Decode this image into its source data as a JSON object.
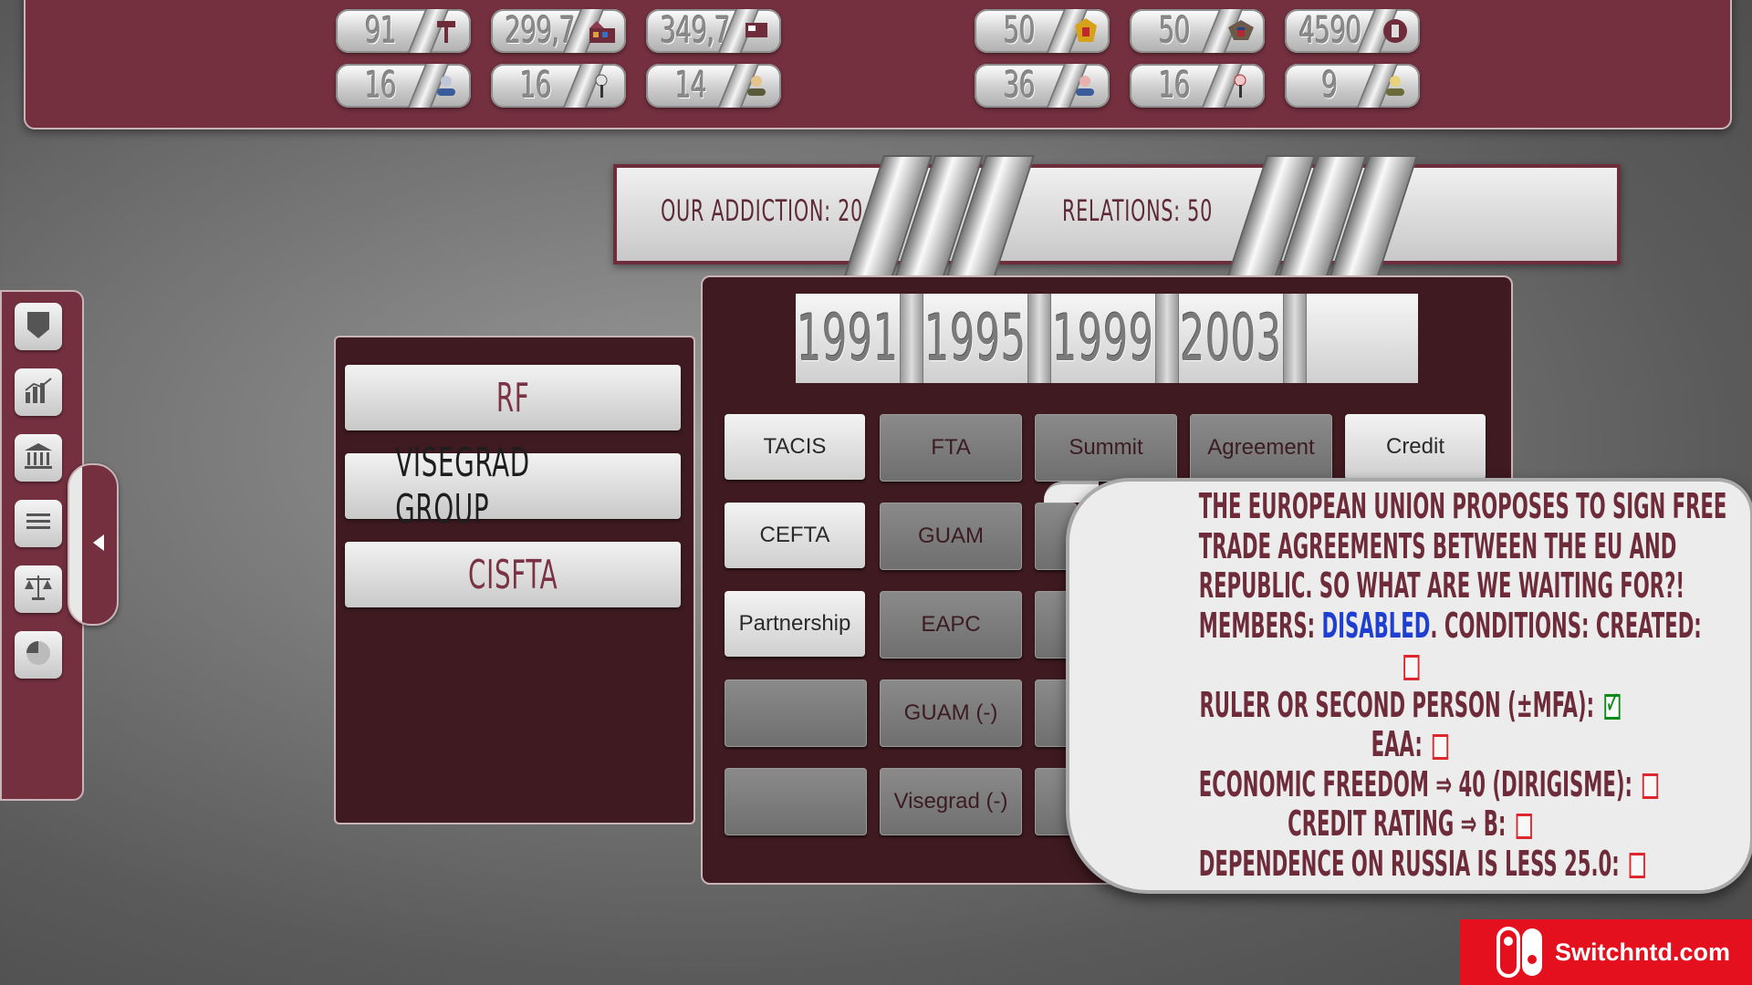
{
  "top_stats": {
    "row1": [
      {
        "value": "91",
        "icon": "tools-icon"
      },
      {
        "value": "299,7",
        "icon": "factory-icon"
      },
      {
        "value": "349,7",
        "icon": "money-flag-icon"
      },
      {
        "value": "50",
        "icon": "russia-eagle-icon"
      },
      {
        "value": "50",
        "icon": "us-eagle-icon"
      },
      {
        "value": "4590",
        "icon": "coin-icon"
      }
    ],
    "row2": [
      {
        "value": "16",
        "icon": "person-icon"
      },
      {
        "value": "16",
        "icon": "microphone-icon"
      },
      {
        "value": "14",
        "icon": "leader-icon"
      },
      {
        "value": "36",
        "icon": "person-red-icon"
      },
      {
        "value": "16",
        "icon": "microphone-red-icon"
      },
      {
        "value": "9",
        "icon": "leader-yellow-icon"
      }
    ]
  },
  "relations": {
    "addiction": "OUR ADDICTION:  20",
    "relations": "RELATIONS: 50"
  },
  "sidebar": [
    "shield-icon",
    "chart-icon",
    "bank-icon",
    "list-icon",
    "scales-icon",
    "pie-chart-icon"
  ],
  "groups": {
    "items": [
      "RF",
      "VISEGRAD GROUP",
      "CISFTA"
    ],
    "active": "VISEGRAD GROUP"
  },
  "years": [
    "1991",
    "1995",
    "1999",
    "2003",
    ""
  ],
  "actions": {
    "col1": [
      "TACIS",
      "CEFTA",
      "Partnership",
      "",
      ""
    ],
    "col2": [
      "FTA",
      "GUAM",
      "EAPC",
      "GUAM (-)",
      "Visegrad (-)"
    ],
    "row1_rest": [
      "Summit",
      "Agreement",
      "Credit"
    ]
  },
  "tooltip": {
    "line1": "THE EUROPEAN UNION PROPOSES TO SIGN FREE",
    "line2": "TRADE AGREEMENTS BETWEEN THE EU AND",
    "line3": "REPUBLIC. SO WHAT ARE WE WAITING FOR?!",
    "members_label": "MEMBERS: ",
    "members_value": "DISABLED",
    "conditions_label": ". CONDITIONS: CREATED:",
    "cond_ruler": "RULER OR SECOND PERSON (±MFA):",
    "cond_eaa": "EAA:",
    "cond_econ": "ECONOMIC FREEDOM ⇒ 40 (DIRIGISME):",
    "cond_credit": "CREDIT RATING ⇒ B:",
    "cond_russia": "DEPENDENCE ON RUSSIA IS LESS 25.0:",
    "created_checked": false,
    "ruler_checked": true,
    "eaa_checked": false,
    "econ_checked": false,
    "credit_checked": false,
    "russia_checked": false
  },
  "watermark": {
    "text": "Switchntd.com"
  },
  "colors": {
    "panel": "#74303f",
    "panel_dark": "#3f1b21",
    "text_maroon": "#6e2c3a",
    "highlight_blue": "#1f3fd0",
    "check_green": "#0b8a1a",
    "check_red": "#e0262d"
  }
}
